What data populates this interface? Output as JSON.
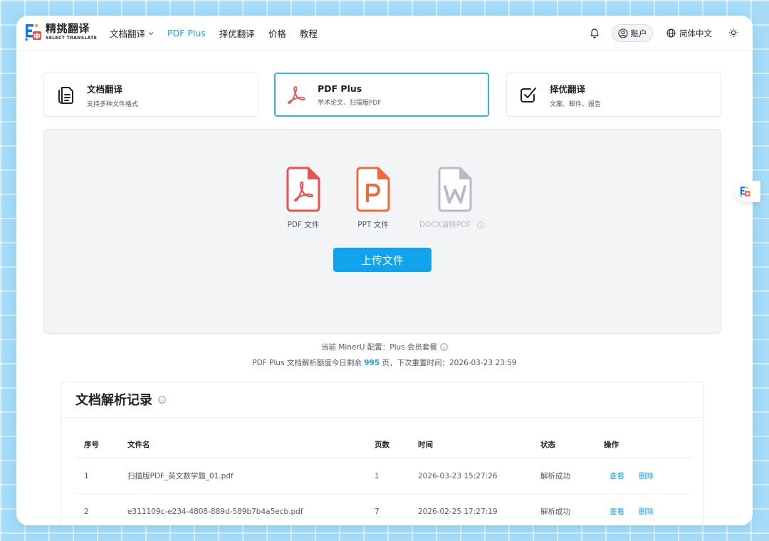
{
  "brand": {
    "name": "精挑翻译",
    "subtitle": "SELECT TRANSLATE"
  },
  "nav": {
    "items": [
      {
        "label": "文档翻译",
        "has_dropdown": true,
        "active": false
      },
      {
        "label": "PDF Plus",
        "has_dropdown": false,
        "active": true
      },
      {
        "label": "择优翻译",
        "has_dropdown": false,
        "active": false
      },
      {
        "label": "价格",
        "has_dropdown": false,
        "active": false
      },
      {
        "label": "教程",
        "has_dropdown": false,
        "active": false
      }
    ]
  },
  "header": {
    "account_label": "账户",
    "language_label": "简体中文",
    "icons": [
      "bell-icon",
      "user-circle-icon",
      "globe-icon",
      "sun-icon"
    ]
  },
  "modes": [
    {
      "title": "文档翻译",
      "desc": "支持多种文件格式",
      "icon": "document-stack-icon",
      "active": false
    },
    {
      "title": "PDF Plus",
      "desc": "学术论文、扫描版PDF",
      "icon": "pdf-acrobat-icon",
      "active": true
    },
    {
      "title": "择优翻译",
      "desc": "文案、邮件、报告",
      "icon": "checkbox-icon",
      "active": false
    }
  ],
  "upload": {
    "file_types": [
      {
        "label": "PDF 文件",
        "icon": "pdf-file-icon",
        "enabled": true
      },
      {
        "label": "PPT 文件",
        "icon": "ppt-file-icon",
        "enabled": true
      },
      {
        "label": "DOCX请转PDF",
        "icon": "word-file-icon",
        "enabled": false
      }
    ],
    "button_label": "上传文件"
  },
  "config": {
    "line1": "当前 MinerU 配置：Plus 会员套餐",
    "line2_prefix": "PDF Plus 文档解析额度今日剩余 ",
    "quota": "995",
    "line2_suffix": " 页，下次重置时间：2026-03-23 23:59"
  },
  "records": {
    "title": "文档解析记录",
    "columns": [
      "序号",
      "文件名",
      "页数",
      "时间",
      "状态",
      "操作"
    ],
    "rows": [
      {
        "idx": "1",
        "name": "扫描版PDF_英文数学题_01.pdf",
        "pages": "1",
        "time": "2026-03-23 15:27:26",
        "status": "解析成功",
        "view": "查看",
        "delete": "删除"
      },
      {
        "idx": "2",
        "name": "e311109c-e234-4808-889d-589b7b4a5ecb.pdf",
        "pages": "7",
        "time": "2026-02-25 17:27:19",
        "status": "解析成功",
        "view": "查看",
        "delete": "删除"
      }
    ]
  },
  "colors": {
    "accent": "#1aa0e8",
    "upload_button": "#11a3ee",
    "pdf_red": "#e8524f",
    "ppt_orange": "#ec6a3c",
    "disabled_gray": "#b6bcc5"
  }
}
